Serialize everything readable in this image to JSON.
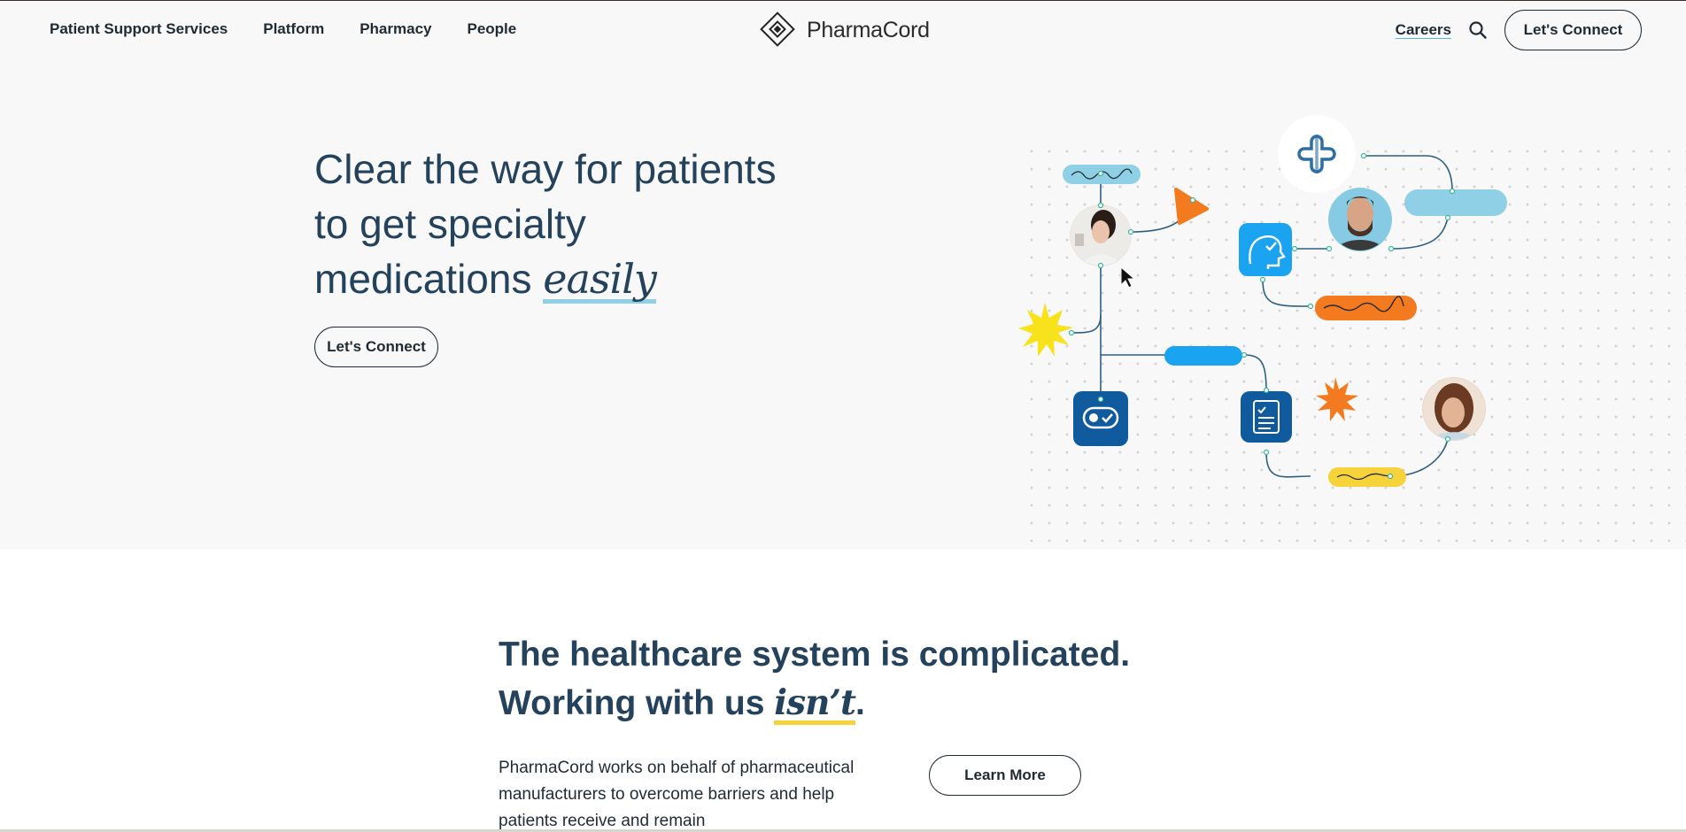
{
  "nav": {
    "left": [
      "Patient Support Services",
      "Platform",
      "Pharmacy",
      "People"
    ],
    "brand": "PharmaCord",
    "careers": "Careers",
    "connect": "Let's Connect"
  },
  "hero": {
    "line1": "Clear the way for patients",
    "line2": "to get specialty",
    "line3": "medications",
    "emphasis": "easily",
    "cta": "Let's Connect"
  },
  "section2": {
    "line1": "The healthcare system is complicated.",
    "line2": "Working with us",
    "emphasis": "isn’t",
    "period": ".",
    "body": "PharmaCord works on behalf of pharmaceutical manufacturers to overcome barriers and help patients receive and remain",
    "cta": "Learn More"
  },
  "icons": {
    "search": "search-icon",
    "logo": "pharmacord-logo-icon",
    "cross": "medical-cross-icon",
    "brain": "brain-check-icon",
    "toggle": "toggle-check-icon",
    "clipboard": "clipboard-checklist-icon",
    "sun": "starburst-icon",
    "cursor": "mouse-cursor-icon"
  },
  "colors": {
    "heading": "#25425c",
    "light_blue": "#8fd0e6",
    "bright_blue": "#1aa3f0",
    "navy": "#0f5b9e",
    "orange": "#f47a1f",
    "yellow": "#f6d23b"
  }
}
